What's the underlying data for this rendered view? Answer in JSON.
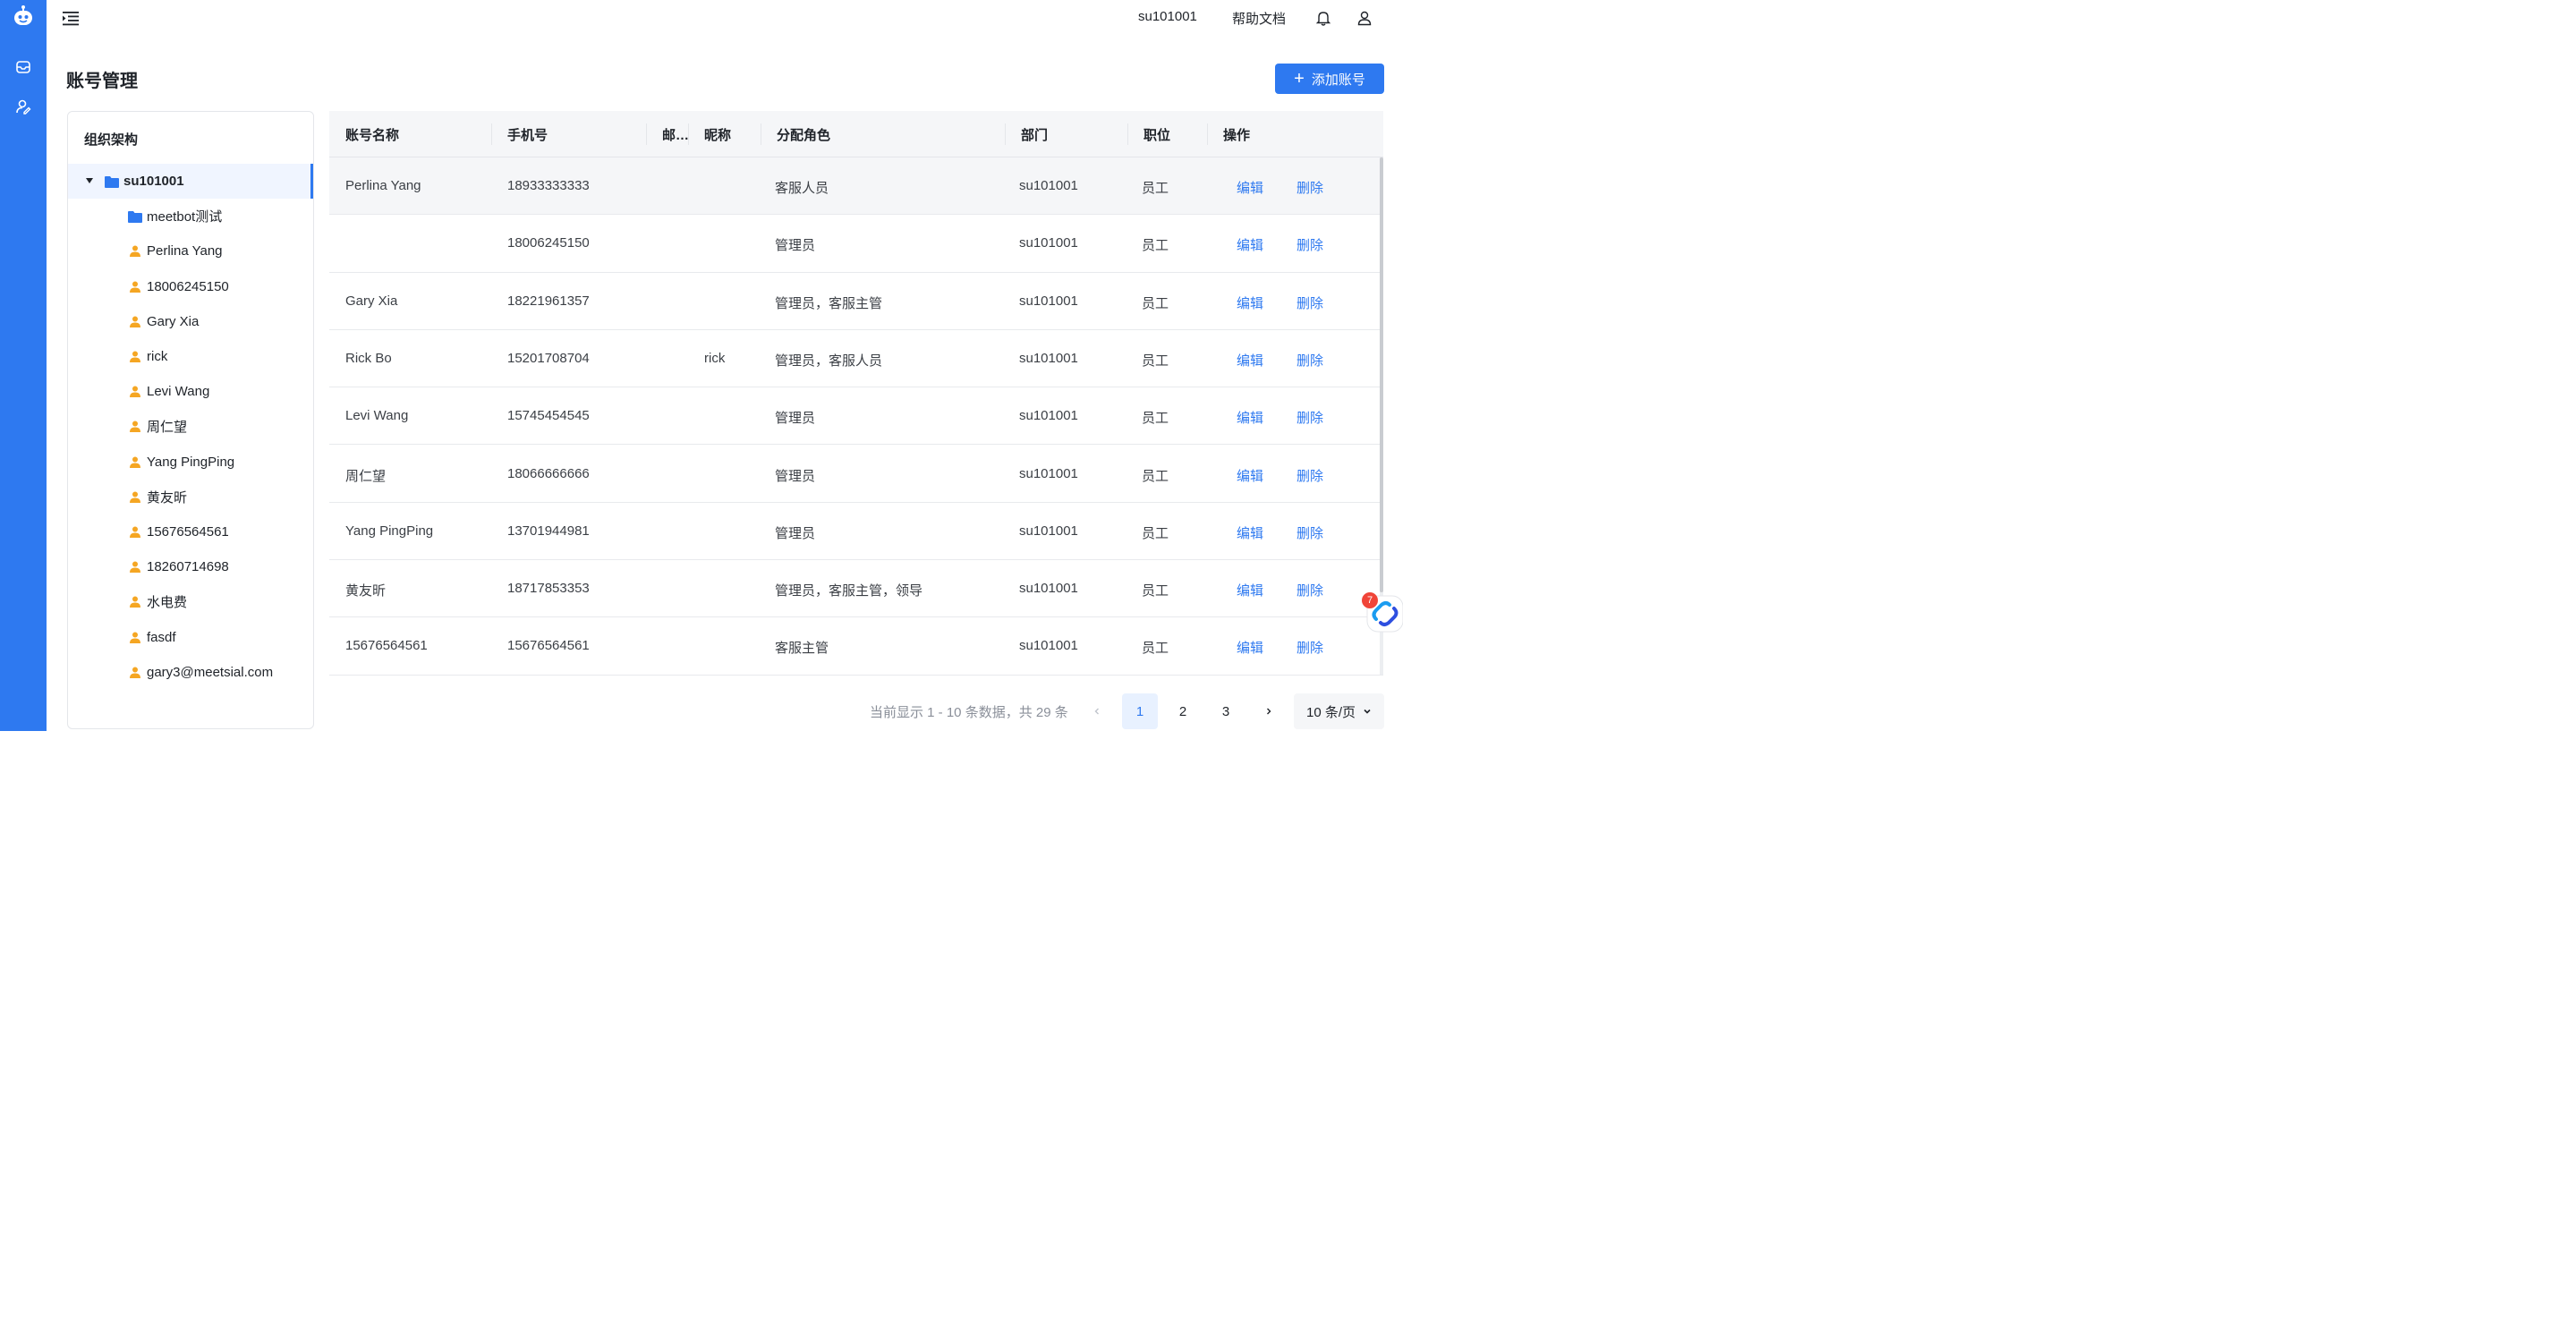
{
  "header": {
    "username": "su101001",
    "help_label": "帮助文档"
  },
  "page": {
    "title": "账号管理",
    "add_button_label": "添加账号"
  },
  "org": {
    "title": "组织架构",
    "root": "su101001",
    "children": [
      {
        "type": "folder",
        "label": "meetbot测试"
      },
      {
        "type": "person",
        "label": "Perlina Yang"
      },
      {
        "type": "person",
        "label": "18006245150"
      },
      {
        "type": "person",
        "label": "Gary Xia"
      },
      {
        "type": "person",
        "label": "rick"
      },
      {
        "type": "person",
        "label": "Levi Wang"
      },
      {
        "type": "person",
        "label": "周仁望"
      },
      {
        "type": "person",
        "label": "Yang PingPing"
      },
      {
        "type": "person",
        "label": "黄友昕"
      },
      {
        "type": "person",
        "label": "15676564561"
      },
      {
        "type": "person",
        "label": "18260714698"
      },
      {
        "type": "person",
        "label": "水电费"
      },
      {
        "type": "person",
        "label": "fasdf"
      },
      {
        "type": "person",
        "label": "gary3@meetsial.com"
      }
    ]
  },
  "table": {
    "columns": [
      "账号名称",
      "手机号",
      "邮…",
      "昵称",
      "分配角色",
      "部门",
      "职位",
      "操作"
    ],
    "edit_label": "编辑",
    "delete_label": "删除",
    "rows": [
      {
        "name": "Perlina Yang",
        "phone": "18933333333",
        "email": "",
        "nickname": "",
        "roles": "客服人员",
        "dept": "su101001",
        "position": "员工"
      },
      {
        "name": "",
        "phone": "18006245150",
        "email": "",
        "nickname": "",
        "roles": "管理员",
        "dept": "su101001",
        "position": "员工"
      },
      {
        "name": "Gary Xia",
        "phone": "18221961357",
        "email": "",
        "nickname": "",
        "roles": "管理员，客服主管",
        "dept": "su101001",
        "position": "员工"
      },
      {
        "name": "Rick Bo",
        "phone": "15201708704",
        "email": "",
        "nickname": "rick",
        "roles": "管理员，客服人员",
        "dept": "su101001",
        "position": "员工"
      },
      {
        "name": "Levi Wang",
        "phone": "15745454545",
        "email": "",
        "nickname": "",
        "roles": "管理员",
        "dept": "su101001",
        "position": "员工"
      },
      {
        "name": "周仁望",
        "phone": "18066666666",
        "email": "",
        "nickname": "",
        "roles": "管理员",
        "dept": "su101001",
        "position": "员工"
      },
      {
        "name": "Yang PingPing",
        "phone": "13701944981",
        "email": "",
        "nickname": "",
        "roles": "管理员",
        "dept": "su101001",
        "position": "员工"
      },
      {
        "name": "黄友昕",
        "phone": "18717853353",
        "email": "",
        "nickname": "",
        "roles": "管理员，客服主管，领导",
        "dept": "su101001",
        "position": "员工"
      },
      {
        "name": "15676564561",
        "phone": "15676564561",
        "email": "",
        "nickname": "",
        "roles": "客服主管",
        "dept": "su101001",
        "position": "员工"
      }
    ]
  },
  "pagination": {
    "info": "当前显示 1 - 10 条数据，共 29 条",
    "pages": [
      "1",
      "2",
      "3"
    ],
    "current": "1",
    "page_size": "10 条/页"
  },
  "widget": {
    "badge_count": "7"
  },
  "colors": {
    "primary": "#2e79f0",
    "header_bg": "#f5f6f8",
    "person_icon": "#f5a623",
    "badge": "#f04438"
  }
}
